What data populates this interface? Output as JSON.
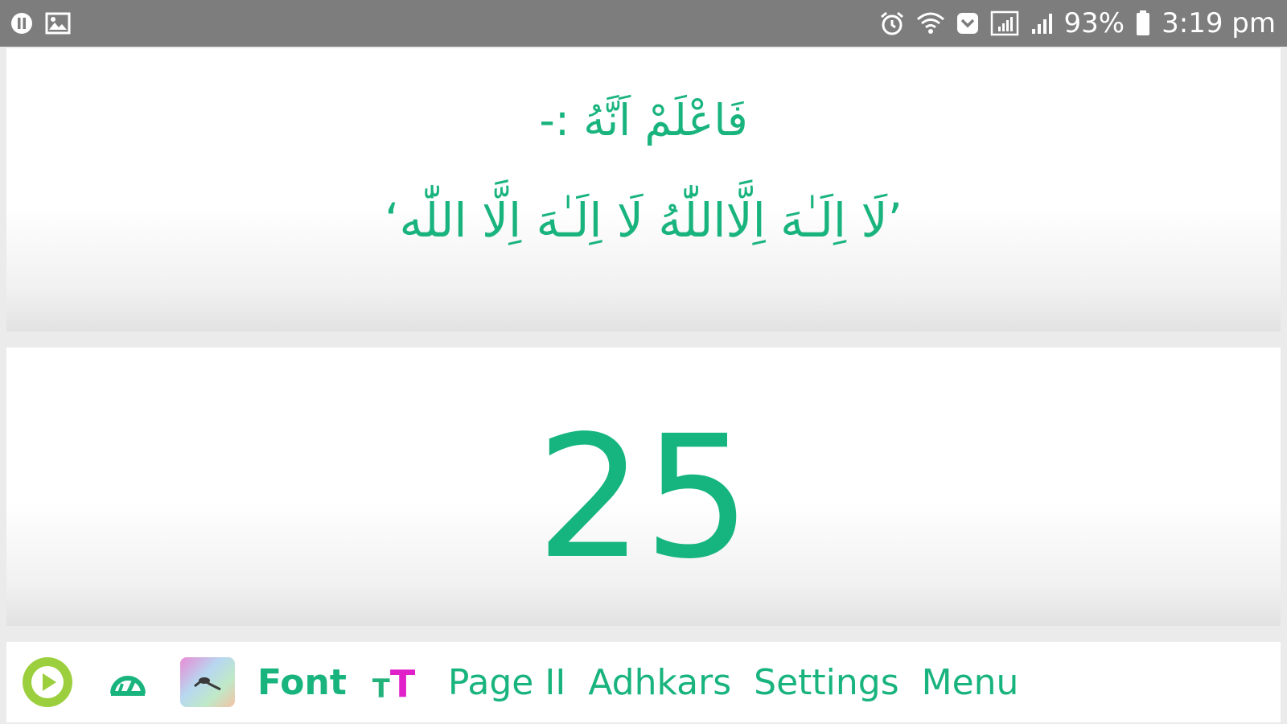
{
  "status_bar": {
    "battery_percent": "93%",
    "time": "3:19 pm"
  },
  "top_panel": {
    "line1": "فَاعْلَمْ اَنَّهُ :-",
    "line2": "’لَا اِلَـٰهَ اِلَّااللّٰهُ لَا اِلَـٰهَ اِلَّا اللّٰه‘"
  },
  "counter": {
    "value": "25"
  },
  "toolbar": {
    "font_label": "Font",
    "tt_small": "T",
    "tt_big": "T",
    "page_label": "Page II",
    "adhkars_label": "Adhkars",
    "settings_label": "Settings",
    "menu_label": "Menu"
  },
  "colors": {
    "accent_green": "#19b47e",
    "play_green": "#9ccf3e",
    "tt_magenta": "#e020c9",
    "status_bar_bg": "#7d7d7d"
  }
}
